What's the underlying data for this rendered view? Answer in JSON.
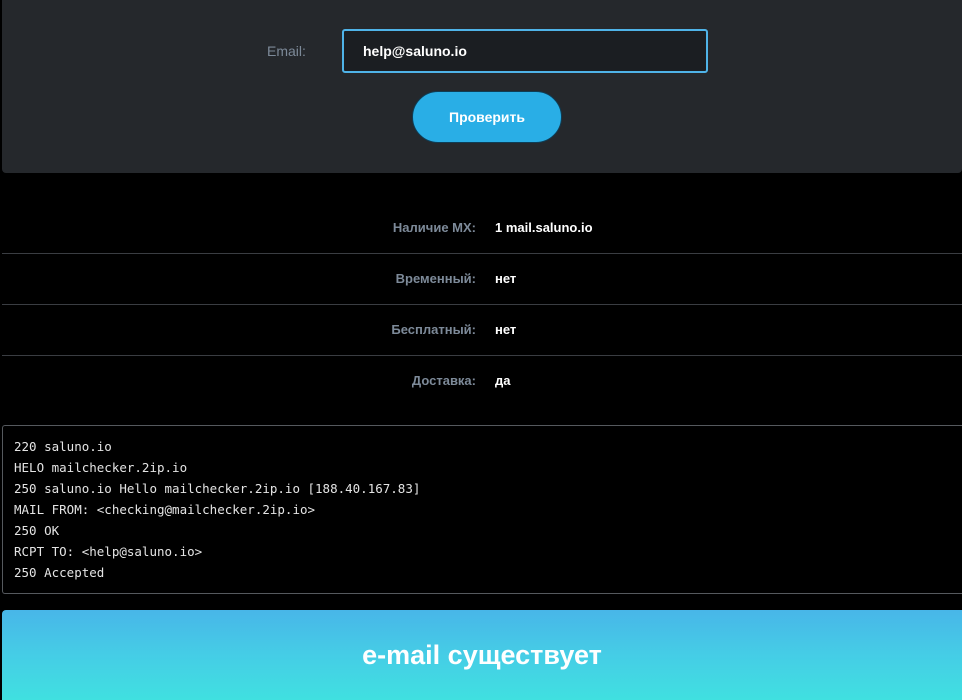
{
  "form": {
    "email_label": "Email:",
    "email_value": "help@saluno.io",
    "check_button_label": "Проверить"
  },
  "results": [
    {
      "label": "Наличие MX:",
      "value": "1 mail.saluno.io"
    },
    {
      "label": "Временный:",
      "value": "нет"
    },
    {
      "label": "Бесплатный:",
      "value": "нет"
    },
    {
      "label": "Доставка:",
      "value": "да"
    }
  ],
  "smtp_log": [
    "220 saluno.io",
    "HELO mailchecker.2ip.io",
    "250 saluno.io Hello mailchecker.2ip.io [188.40.167.83]",
    "MAIL FROM: <checking@mailchecker.2ip.io>",
    "250 OK",
    "RCPT TO: <help@saluno.io>",
    "250 Accepted"
  ],
  "verdict": {
    "text": "e-mail существует"
  },
  "colors": {
    "panel_bg": "#25282c",
    "accent": "#29aee6",
    "input_border": "#4fb3e8",
    "label": "#7d8a99",
    "banner_top": "#48b6e8",
    "banner_bottom": "#40e0e0"
  }
}
